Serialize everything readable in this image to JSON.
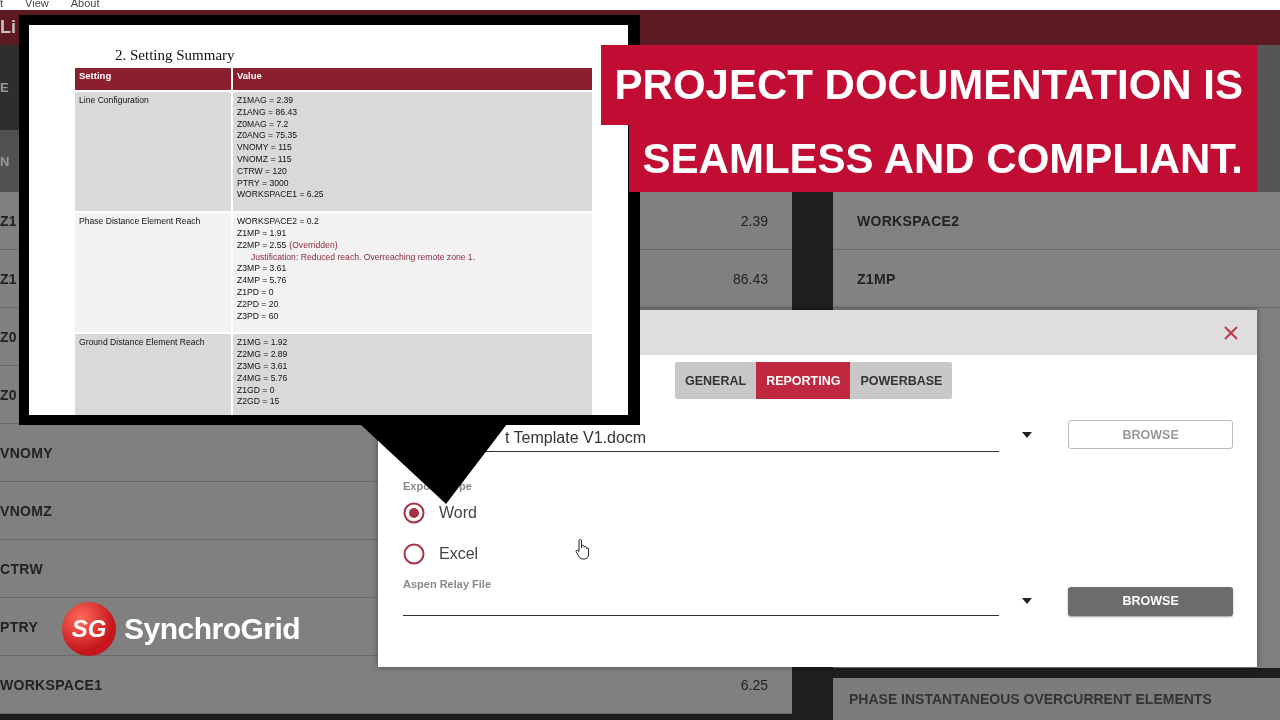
{
  "menu_bar": {
    "items": [
      "t",
      "View",
      "About"
    ]
  },
  "app_title": "Li",
  "left_panel": {
    "headers": [
      "E",
      "N"
    ],
    "rows": [
      {
        "label": "Z1",
        "value": "2.39"
      },
      {
        "label": "Z1",
        "value": "86.43"
      },
      {
        "label": "Z0"
      },
      {
        "label": "Z0"
      },
      {
        "label": "VNOMY"
      },
      {
        "label": "VNOMZ"
      },
      {
        "label": "CTRW"
      },
      {
        "label": "PTRY"
      },
      {
        "label": "WORKSPACE1",
        "value": "6.25"
      }
    ]
  },
  "right_panel": {
    "rows": [
      {
        "label": "WORKSPACE2"
      },
      {
        "label": "Z1MP"
      }
    ],
    "section_title": "PHASE INSTANTANEOUS OVERCURRENT ELEMENTS"
  },
  "banner": {
    "lines": [
      "PROJECT DOCUMENTATION IS",
      "SEAMLESS AND COMPLIANT."
    ]
  },
  "document": {
    "heading": "2. Setting Summary",
    "columns": [
      "Setting",
      "Value"
    ],
    "rows": [
      {
        "setting": "Line Configuration",
        "values": [
          {
            "text": "Z1MAG = 2.39"
          },
          {
            "text": "Z1ANG = 86.43"
          },
          {
            "text": "Z0MAG = 7.2"
          },
          {
            "text": "Z0ANG = 75.35"
          },
          {
            "text": "VNOMY = 115"
          },
          {
            "text": "VNOMZ = 115"
          },
          {
            "text": "CTRW = 120"
          },
          {
            "text": "PTRY = 3000"
          },
          {
            "text": "WORKSPACE1 = 6.25"
          }
        ]
      },
      {
        "setting": "Phase Distance Element Reach",
        "values": [
          {
            "text": "WORKSPACE2 = 0.2"
          },
          {
            "text": "Z1MP = 1.91"
          },
          {
            "text": "Z2MP = 2.55",
            "note": "(Overridden)",
            "justification": "Justification: Reduced reach. Overreaching remote zone 1."
          },
          {
            "text": "Z3MP = 3.61"
          },
          {
            "text": "Z4MP = 5.76"
          },
          {
            "text": "Z1PD = 0"
          },
          {
            "text": "Z2PD = 20"
          },
          {
            "text": "Z3PD = 60"
          }
        ]
      },
      {
        "setting": "Ground Distance Element Reach",
        "values": [
          {
            "text": "Z1MG = 1.92"
          },
          {
            "text": "Z2MG = 2.89"
          },
          {
            "text": "Z3MG = 3.61"
          },
          {
            "text": "Z4MG = 5.76"
          },
          {
            "text": "Z1GD = 0"
          },
          {
            "text": "Z2GD = 15"
          }
        ]
      }
    ]
  },
  "dialog": {
    "tabs": [
      {
        "label": "GENERAL",
        "selected": false
      },
      {
        "label": "REPORTING",
        "selected": true
      },
      {
        "label": "POWERBASE",
        "selected": false
      }
    ],
    "template_field": {
      "value": "t Template V1.docm"
    },
    "export_type": {
      "label_parts": [
        "Expo",
        "pe"
      ],
      "options": [
        {
          "label": "Word",
          "selected": true
        },
        {
          "label": "Excel",
          "selected": false
        }
      ]
    },
    "relay_field": {
      "label": "Aspen Relay File"
    },
    "buttons": [
      {
        "label": "BROWSE",
        "disabled": true
      },
      {
        "label": "BROWSE",
        "disabled": false
      }
    ]
  },
  "logo": {
    "mark": "SG",
    "text": "SynchroGrid"
  }
}
